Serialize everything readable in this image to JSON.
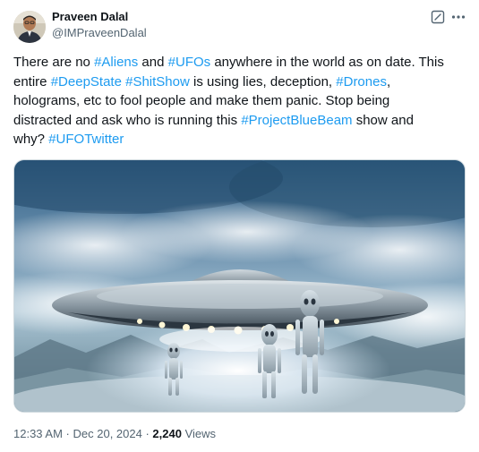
{
  "author": {
    "display_name": "Praveen Dalal",
    "handle": "@IMPraveenDalal",
    "avatar_icon": "person-avatar"
  },
  "header_icons": [
    "grok-icon",
    "more-options-icon"
  ],
  "tweet": {
    "lines": [
      [
        {
          "text": "There are no ",
          "tag": false
        },
        {
          "text": "#Aliens",
          "tag": true
        },
        {
          "text": " and ",
          "tag": false
        },
        {
          "text": "#UFOs",
          "tag": true
        },
        {
          "text": " anywhere in the world as on date. This",
          "tag": false
        }
      ],
      [
        {
          "text": "entire ",
          "tag": false
        },
        {
          "text": "#DeepState",
          "tag": true
        },
        {
          "text": " ",
          "tag": false
        },
        {
          "text": "#ShitShow",
          "tag": true
        },
        {
          "text": " is using lies, deception, ",
          "tag": false
        },
        {
          "text": "#Drones",
          "tag": true
        },
        {
          "text": ",",
          "tag": false
        }
      ],
      [
        {
          "text": "holograms, etc to fool people and make them panic. Stop being",
          "tag": false
        }
      ],
      [
        {
          "text": "distracted and ask who is running this ",
          "tag": false
        },
        {
          "text": "#ProjectBlueBeam",
          "tag": true
        },
        {
          "text": " show and",
          "tag": false
        }
      ],
      [
        {
          "text": "why? ",
          "tag": false
        },
        {
          "text": "#UFOTwitter",
          "tag": true
        }
      ]
    ]
  },
  "media": {
    "description_icon": "ufo-image",
    "colors": {
      "sky_top": "#2f5f86",
      "sky_mid": "#8fb2c9",
      "glow": "#eaf6ff",
      "ground": "#4d6a78"
    }
  },
  "meta": {
    "time": "12:33 AM",
    "separator": " · ",
    "date": "Dec 20, 2024",
    "views_count": "2,240",
    "views_label": " Views"
  },
  "colors": {
    "link": "#1d9bf0",
    "text": "#0f1419",
    "muted": "#536471",
    "border": "#cfd9de"
  }
}
